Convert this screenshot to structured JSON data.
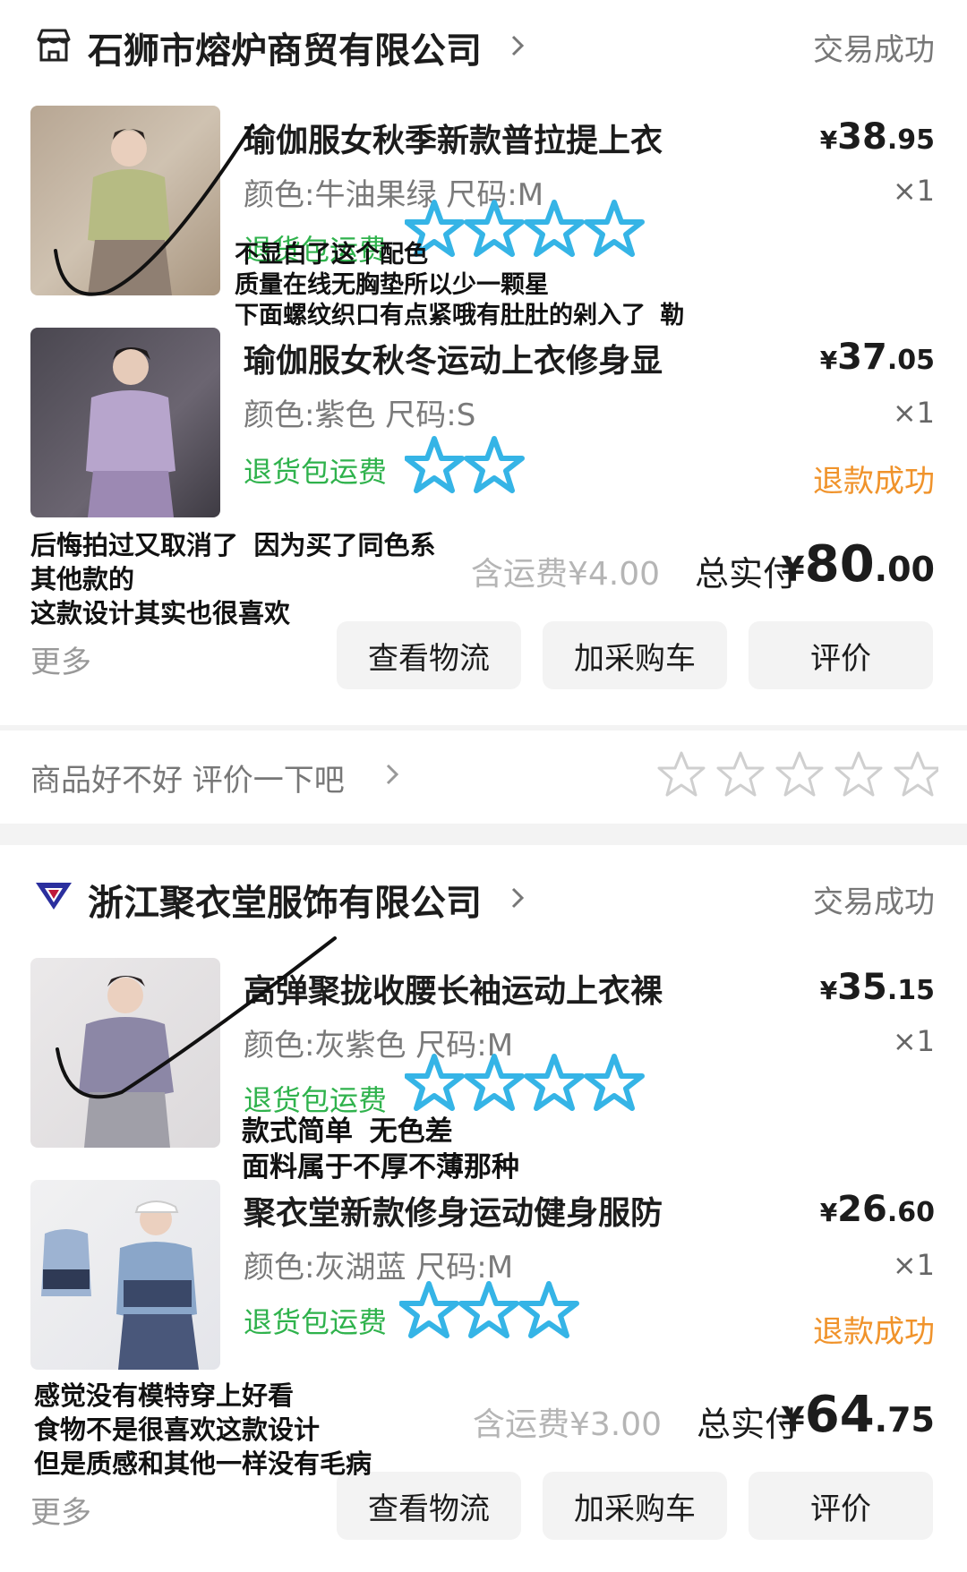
{
  "orders": [
    {
      "shop_name": "石狮市熔炉商贸有限公司",
      "status": "交易成功",
      "items": [
        {
          "title": "瑜伽服女秋季新款普拉提上衣",
          "spec": "颜色:牛油果绿 尺码:M",
          "badge": "退货包运费",
          "price_currency": "¥",
          "price_int": "38",
          "price_dec": ".95",
          "qty": "×1",
          "note": "不显白了这个配色\n质量在线无胸垫所以少一颗星\n下面螺纹织口有点紧哦有肚肚的剁入了 勒",
          "stars": 4
        },
        {
          "title": "瑜伽服女秋冬运动上衣修身显",
          "spec": "颜色:紫色 尺码:S",
          "badge": "退货包运费",
          "price_currency": "¥",
          "price_int": "37",
          "price_dec": ".05",
          "qty": "×1",
          "refund": "退款成功",
          "stars": 2
        }
      ],
      "order_note": "后悔拍过又取消了 因为买了同色系\n其他款的\n这款设计其实也很喜欢",
      "shipping": "含运费¥4.00",
      "total_label": "总实付",
      "total_currency": "¥",
      "total_int": "80",
      "total_dec": ".00",
      "more": "更多",
      "buttons": [
        "查看物流",
        "加采购车",
        "评价"
      ]
    },
    {
      "shop_name": "浙江聚衣堂服饰有限公司",
      "status": "交易成功",
      "items": [
        {
          "title": "高弹聚拢收腰长袖运动上衣裸",
          "spec": "颜色:灰紫色 尺码:M",
          "badge": "退货包运费",
          "price_currency": "¥",
          "price_int": "35",
          "price_dec": ".15",
          "qty": "×1",
          "note": "款式简单 无色差\n面料属于不厚不薄那种",
          "stars": 4
        },
        {
          "title": "聚衣堂新款修身运动健身服防",
          "spec": "颜色:灰湖蓝 尺码:M",
          "badge": "退货包运费",
          "price_currency": "¥",
          "price_int": "26",
          "price_dec": ".60",
          "qty": "×1",
          "refund": "退款成功",
          "stars": 3
        }
      ],
      "order_note": "感觉没有模特穿上好看\n食物不是很喜欢这款设计\n但是质感和其他一样没有毛病",
      "shipping": "含运费¥3.00",
      "total_label": "总实付",
      "total_currency": "¥",
      "total_int": "64",
      "total_dec": ".75",
      "more": "更多",
      "buttons": [
        "查看物流",
        "加采购车",
        "评价"
      ]
    }
  ],
  "review_prompt": {
    "text": "商品好不好 评价一下吧",
    "star_count": 5
  },
  "colors": {
    "green_badge": "#2fb24c",
    "refund_orange": "#f0932b",
    "doodle_star": "#35b4e6",
    "button_bg": "#f3f3f3"
  }
}
